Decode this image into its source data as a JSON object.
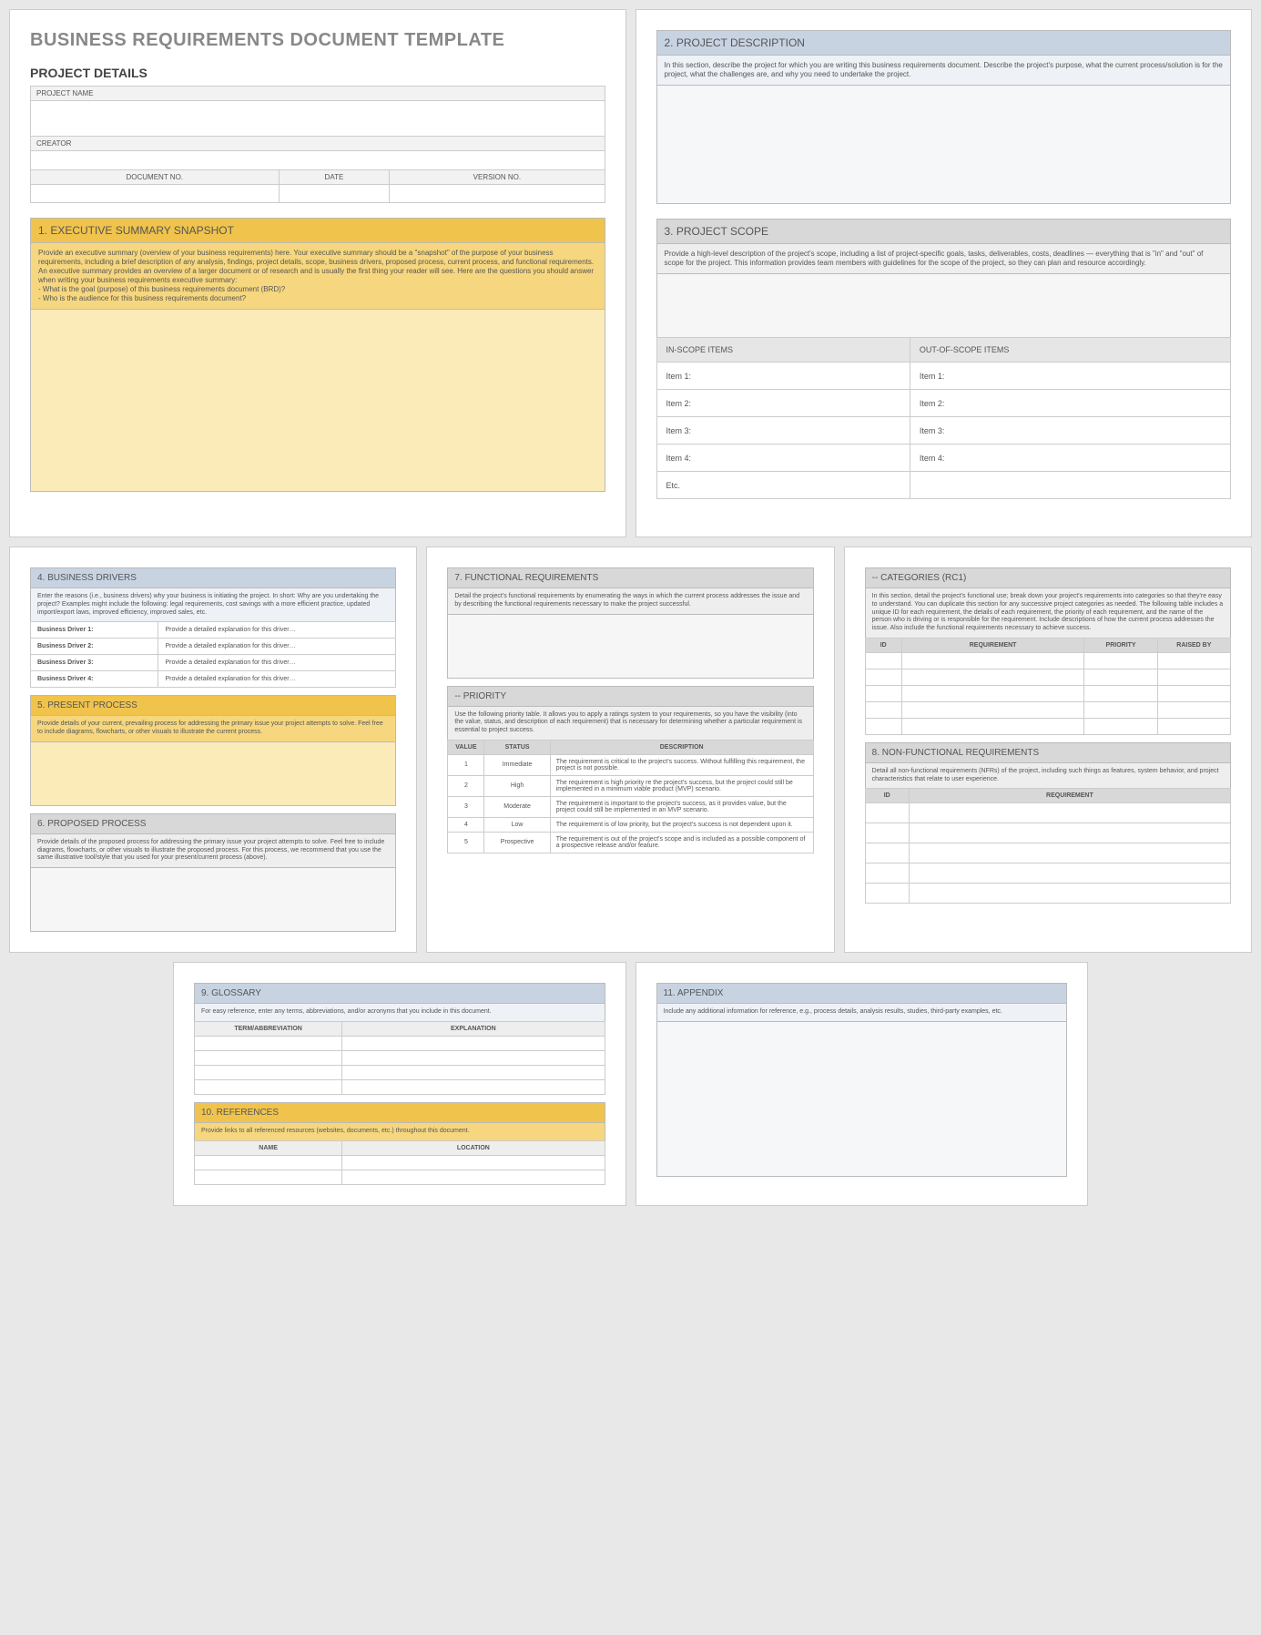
{
  "doc_title": "BUSINESS REQUIREMENTS DOCUMENT TEMPLATE",
  "project_details_heading": "PROJECT DETAILS",
  "fields": {
    "project_name_label": "PROJECT NAME",
    "creator_label": "CREATOR",
    "doc_no_label": "DOCUMENT NO.",
    "date_label": "DATE",
    "version_label": "VERSION NO."
  },
  "s1": {
    "title": "1. EXECUTIVE SUMMARY SNAPSHOT",
    "desc": "Provide an executive summary (overview of your business requirements) here. Your executive summary should be a \"snapshot\" of the purpose of your business requirements, including a brief description of any analysis, findings, project details, scope, business drivers, proposed process, current process, and functional requirements. An executive summary provides an overview of a larger document or of research and is usually the first thing your reader will see. Here are the questions you should answer when writing your business requirements executive summary:\n- What is the goal (purpose) of this business requirements document (BRD)?\n- Who is the audience for this business requirements document?"
  },
  "s2": {
    "title": "2. PROJECT DESCRIPTION",
    "desc": "In this section, describe the project for which you are writing this business requirements document. Describe the project's purpose, what the current process/solution is for the project, what the challenges are, and why you need to undertake the project."
  },
  "s3": {
    "title": "3. PROJECT SCOPE",
    "desc": "Provide a high-level description of the project's scope, including a list of project-specific goals, tasks, deliverables, costs, deadlines — everything that is \"in\" and \"out\" of scope for the project. This information provides team members with guidelines for the scope of the project, so they can plan and resource accordingly.",
    "in_header": "IN-SCOPE ITEMS",
    "out_header": "OUT-OF-SCOPE ITEMS",
    "rows": [
      "Item 1:",
      "Item 2:",
      "Item 3:",
      "Item 4:",
      "Etc."
    ]
  },
  "s4": {
    "title": "4. BUSINESS DRIVERS",
    "desc": "Enter the reasons (i.e., business drivers) why your business is initiating the project. In short: Why are you undertaking the project? Examples might include the following: legal requirements, cost savings with a more efficient practice, updated import/export laws, improved efficiency, improved sales, etc.",
    "rows": [
      {
        "name": "Business Driver 1:",
        "detail": "Provide a detailed explanation for this driver…"
      },
      {
        "name": "Business Driver 2:",
        "detail": "Provide a detailed explanation for this driver…"
      },
      {
        "name": "Business Driver 3:",
        "detail": "Provide a detailed explanation for this driver…"
      },
      {
        "name": "Business Driver 4:",
        "detail": "Provide a detailed explanation for this driver…"
      }
    ]
  },
  "s5": {
    "title": "5. PRESENT PROCESS",
    "desc": "Provide details of your current, prevailing process for addressing the primary issue your project attempts to solve. Feel free to include diagrams, flowcharts, or other visuals to illustrate the current process."
  },
  "s6": {
    "title": "6. PROPOSED PROCESS",
    "desc": "Provide details of the proposed process for addressing the primary issue your project attempts to solve. Feel free to include diagrams, flowcharts, or other visuals to illustrate the proposed process. For this process, we recommend that you use the same illustrative tool/style that you used for your present/current process (above)."
  },
  "s7": {
    "title": "7. FUNCTIONAL REQUIREMENTS",
    "desc": "Detail the project's functional requirements by enumerating the ways in which the current process addresses the issue and by describing the functional requirements necessary to make the project successful."
  },
  "s7p": {
    "title": "-- PRIORITY",
    "desc": "Use the following priority table. It allows you to apply a ratings system to your requirements, so you have the visibility (into the value, status, and description of each requirement) that is necessary for determining whether a particular requirement is essential to project success.",
    "headers": [
      "VALUE",
      "STATUS",
      "DESCRIPTION"
    ],
    "rows": [
      {
        "v": "1",
        "s": "Immediate",
        "d": "The requirement is critical to the project's success. Without fulfilling this requirement, the project is not possible."
      },
      {
        "v": "2",
        "s": "High",
        "d": "The requirement is high priority re the project's success, but the project could still be implemented in a minimum viable product (MVP) scenario."
      },
      {
        "v": "3",
        "s": "Moderate",
        "d": "The requirement is important to the project's success, as it provides value, but the project could still be implemented in an MVP scenario."
      },
      {
        "v": "4",
        "s": "Low",
        "d": "The requirement is of low priority, but the project's success is not dependent upon it."
      },
      {
        "v": "5",
        "s": "Prospective",
        "d": "The requirement is out of the project's scope and is included as a possible component of a prospective release and/or feature."
      }
    ]
  },
  "s7c": {
    "title": "-- CATEGORIES (RC1)",
    "desc": "In this section, detail the project's functional use; break down your project's requirements into categories so that they're easy to understand. You can duplicate this section for any successive project categories as needed. The following table includes a unique ID for each requirement, the details of each requirement, the priority of each requirement, and the name of the person who is driving or is responsible for the requirement. Include descriptions of how the current process addresses the issue. Also include the functional requirements necessary to achieve success.",
    "headers": [
      "ID",
      "REQUIREMENT",
      "PRIORITY",
      "RAISED BY"
    ]
  },
  "s8": {
    "title": "8. NON-FUNCTIONAL REQUIREMENTS",
    "desc": "Detail all non-functional requirements (NFRs) of the project, including such things as features, system behavior, and project characteristics that relate to user experience.",
    "headers": [
      "ID",
      "REQUIREMENT"
    ]
  },
  "s9": {
    "title": "9. GLOSSARY",
    "desc": "For easy reference, enter any terms, abbreviations, and/or acronyms that you include in this document.",
    "headers": [
      "TERM/ABBREVIATION",
      "EXPLANATION"
    ]
  },
  "s10": {
    "title": "10. REFERENCES",
    "desc": "Provide links to all referenced resources (websites, documents, etc.) throughout this document.",
    "headers": [
      "NAME",
      "LOCATION"
    ]
  },
  "s11": {
    "title": "11. APPENDIX",
    "desc": "Include any additional information for reference, e.g., process details, analysis results, studies, third-party examples, etc."
  }
}
